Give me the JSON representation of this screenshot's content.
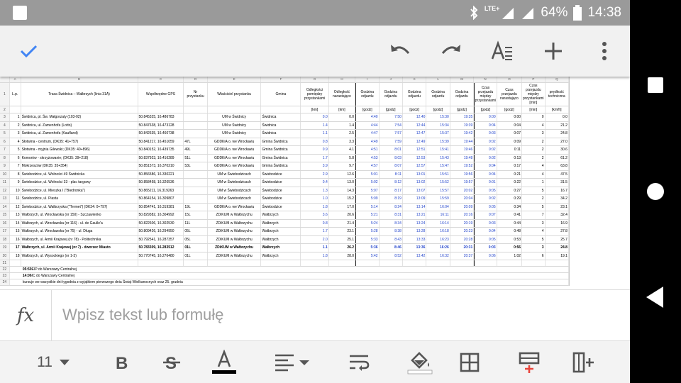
{
  "status_bar": {
    "network": "LTE+",
    "battery": "64%",
    "time": "14:38"
  },
  "toolbar": {
    "confirm_icon": "check-icon",
    "undo_icon": "undo-icon",
    "redo_icon": "redo-icon",
    "format_icon": "text-format-icon",
    "insert_icon": "plus-icon",
    "more_icon": "more-vert-icon"
  },
  "sheet": {
    "col_letters": [
      "",
      "A",
      "B",
      "C",
      "D",
      "E",
      "F",
      "G",
      "H",
      "I",
      "J",
      "K",
      "L",
      "M",
      "N",
      "O",
      "P",
      "Q"
    ],
    "header_row": {
      "num": "1",
      "cells": [
        "L.p.",
        "Trasa Świdnica – Wałbrzych (linia 31A)",
        "Współrzędne GPS",
        "Nr przystanku",
        "Właściciel przystanku",
        "Gmina",
        "Odległości pomiędzy przystankami",
        "Odległość narastająco",
        "Godzina odjazdu",
        "Godzina odjazdu",
        "Godzina odjazdu",
        "Godzina odjazdu",
        "Godzina odjazdu",
        "Czas przejazdu między przystankami",
        "Czas przejazdu narastająco",
        "Czas przejazdu między przystankami [min]",
        "prędkość techniczna"
      ]
    },
    "units_row": {
      "num": "2",
      "cells": [
        "",
        "",
        "",
        "",
        "",
        "",
        "[km]",
        "[km]",
        "[godz]",
        "[godz]",
        "[godz]",
        "[godz]",
        "[godz]",
        "[godz]",
        "[godz]",
        "[min]",
        "[km/h]"
      ]
    },
    "rows": [
      {
        "n": "3",
        "c": [
          "1",
          "Świdnica, pl. Św. Małgorzaty (103-02)",
          "50.845325, 16.486783",
          "",
          "UM w Świdnicy",
          "Świdnica",
          "0.0",
          "0.0",
          "4:40",
          "7:50",
          "12:40",
          "15:30",
          "19:35",
          "0:00",
          "0:00",
          "0",
          "0.0"
        ]
      },
      {
        "n": "4",
        "c": [
          "2",
          "Świdnica, ul. Zamenhofa (Lotto)",
          "50.847638, 16.473128",
          "",
          "UM w Świdnicy",
          "Świdnica",
          "1.4",
          "1.4",
          "4:44",
          "7:54",
          "12:44",
          "15:34",
          "19:39",
          "0:04",
          "0:04",
          "4",
          "21.2"
        ]
      },
      {
        "n": "5",
        "c": [
          "3",
          "Świdnica, ul. Zamenhofa (Kaufland)",
          "50.842635, 16.460738",
          "",
          "UM w Świdnicy",
          "Świdnica",
          "1.1",
          "2.5",
          "4:47",
          "7:57",
          "12:47",
          "15:37",
          "19:42",
          "0:03",
          "0:07",
          "3",
          "24.8"
        ]
      },
      {
        "n": "6",
        "c": [
          "4",
          "Słotwina - centrum, (DK35: 41+757)",
          "50.841217, 16.451059",
          "47L",
          "GDDKiA o. we Wrocławiu",
          "Gmina Świdnica",
          "0.8",
          "3.3",
          "4:49",
          "7:59",
          "12:49",
          "15:39",
          "19:44",
          "0:02",
          "0:09",
          "2",
          "27.0"
        ]
      },
      {
        "n": "7",
        "c": [
          "5",
          "Słotwina - myjnia Gilewski; (DK35: 40+896)",
          "50.840152, 16.439735",
          "49L",
          "GDDKiA o. we Wrocławiu",
          "Gmina Świdnica",
          "0.9",
          "4.1",
          "4:51",
          "8:01",
          "12:51",
          "15:41",
          "19:46",
          "0:02",
          "0:11",
          "2",
          "30.6"
        ]
      },
      {
        "n": "8",
        "c": [
          "6",
          "Komorów - skrzyżowanie; (DK35: 39+218)",
          "50.837923, 16.416289",
          "51L",
          "GDDKiA o. we Wrocławiu",
          "Gmina Świdnica",
          "1.7",
          "5.8",
          "4:53",
          "8:03",
          "12:53",
          "15:43",
          "19:48",
          "0:02",
          "0:13",
          "2",
          "61.2"
        ]
      },
      {
        "n": "9",
        "c": [
          "7",
          "Mokrzeszów (DK35: 35+354)",
          "50.851573, 16.370210",
          "53L",
          "GDDKiA o. we Wrocławiu",
          "Gmina Świdnica",
          "3.9",
          "9.7",
          "4:57",
          "8:07",
          "12:57",
          "15:47",
          "19:52",
          "0:04",
          "0:17",
          "4",
          "63.8"
        ]
      },
      {
        "n": "10",
        "c": [
          "8",
          "Świebodzice, ul. Wolności 49 Świdnicka",
          "50.856586, 16.330221",
          "",
          "UM w Świebodzicach",
          "Świebodzice",
          "2.9",
          "12.6",
          "5:01",
          "8:11",
          "13:01",
          "15:51",
          "19:56",
          "0:04",
          "0:21",
          "4",
          "47.5"
        ]
      },
      {
        "n": "11",
        "c": [
          "9",
          "Świebodzice, ul. Wolności 33 - plac targowy",
          "50.858458, 16.326536",
          "",
          "UM w Świebodzicach",
          "Świebodzice",
          "0.4",
          "13.0",
          "5:02",
          "8:12",
          "13:02",
          "15:52",
          "19:57",
          "0:01",
          "0:22",
          "1",
          "31.5"
        ]
      },
      {
        "n": "12",
        "c": [
          "10",
          "Świebodzice, ul. Mieszka I (\"Biedronka\")",
          "50.865211, 16.319263",
          "",
          "UM w Świebodzicach",
          "Świebodzice",
          "1.3",
          "14.3",
          "5:07",
          "8:17",
          "13:07",
          "15:57",
          "20:02",
          "0:05",
          "0:27",
          "5",
          "16.7"
        ]
      },
      {
        "n": "13",
        "c": [
          "11",
          "Świebodzice, ul. Piasta",
          "50.864154, 16.309807",
          "",
          "UM w Świebodzicach",
          "Świebodzice",
          "1.0",
          "15.2",
          "5:09",
          "8:19",
          "13:09",
          "15:59",
          "20:04",
          "0:02",
          "0:29",
          "2",
          "34.2"
        ]
      },
      {
        "n": "14",
        "c": [
          "12",
          "Świebodzice, ul. Wałbrzyska (\"Termet\") (DK34: 0+797)",
          "50.854741, 16.319381",
          "19L",
          "GDDKiA o. we Wrocławiu",
          "Świebodzice",
          "1.8",
          "17.0",
          "5:14",
          "8:24",
          "13:14",
          "16:04",
          "20:09",
          "0:05",
          "0:34",
          "5",
          "23.1"
        ]
      },
      {
        "n": "15",
        "c": [
          "13",
          "Wałbrzych, ul. Wrocławska (nr 150) - Szczawienko",
          "50.829382, 16.304992",
          "15L",
          "ZDiKUM w Wałbrzychu",
          "Wałbrzych",
          "3.6",
          "20.6",
          "5:21",
          "8:31",
          "13:21",
          "16:11",
          "20:16",
          "0:07",
          "0:41",
          "7",
          "32.4"
        ]
      },
      {
        "n": "16",
        "c": [
          "14",
          "Wałbrzych, ul. Wrocławska (nr 116) - ul. de Gaulle'a",
          "50.822606, 16.302530",
          "11L",
          "ZDiKUM w Wałbrzychu",
          "Wałbrzych",
          "0.8",
          "21.4",
          "5:24",
          "8:34",
          "13:24",
          "16:14",
          "20:19",
          "0:03",
          "0:44",
          "3",
          "16.9"
        ]
      },
      {
        "n": "17",
        "c": [
          "15",
          "Wałbrzych, ul. Wrocławska (nr 75) - ul. Długa",
          "50.809426, 16.294950",
          "05L",
          "ZDiKUM w Wałbrzychu",
          "Wałbrzych",
          "1.7",
          "23.1",
          "5:28",
          "8:38",
          "13:28",
          "16:18",
          "20:23",
          "0:04",
          "0:48",
          "4",
          "27.8"
        ]
      },
      {
        "n": "18",
        "c": [
          "16",
          "Wałbrzych, ul. Armii Krajowej (nr 78) - Politechnika",
          "50.792541, 16.287357",
          "05L",
          "ZDiKUM w Wałbrzychu",
          "Wałbrzych",
          "2.0",
          "25.1",
          "5:33",
          "8:43",
          "13:33",
          "16:23",
          "20:28",
          "0:05",
          "0:53",
          "5",
          "25.7"
        ]
      },
      {
        "n": "19",
        "bold": true,
        "c": [
          "17",
          "Wałbrzych, ul. Armii Krajowej (nr 7) - dworzec Miasto",
          "50.783309, 16.283512",
          "01L",
          "ZDiKUM w Wałbrzychu",
          "Wałbrzych",
          "1.1",
          "26.2",
          "5:36",
          "8:46",
          "13:36",
          "16:26",
          "20:31",
          "0:03",
          "0:56",
          "3",
          "24.8"
        ]
      },
      {
        "n": "20",
        "c": [
          "18",
          "Wałbrzych, ul. Wysockiego (nr 1-3)",
          "50.770745, 16.276480",
          "01L",
          "ZDiKUM w Wałbrzychu",
          "Wałbrzych",
          "1.8",
          "28.0",
          "5:42",
          "8:52",
          "13:42",
          "16:32",
          "20:37",
          "0:06",
          "1:02",
          "6",
          "19.1"
        ]
      }
    ],
    "empty_row_21": "21",
    "notes": [
      {
        "n": "22",
        "bold_part": "05:59",
        "text": " EIP do Warszawy Centralnej"
      },
      {
        "n": "23",
        "bold_part": "14:06",
        "text": " IC do Warszawy Centralnej"
      },
      {
        "n": "24",
        "bold_part": "",
        "text": "kursuje we wszystkie dni tygodnia z wyjątkiem pierwszego dnia Świąt Wielkanocnych oraz 25. grudnia"
      }
    ]
  },
  "formula_bar": {
    "fx_label": "fx",
    "placeholder": "Wpisz tekst lub formułę"
  },
  "format_bar": {
    "font_size": "11",
    "icons": [
      "bold-icon",
      "strikethrough-icon",
      "text-color-icon",
      "align-icon",
      "wrap-text-icon",
      "fill-color-icon",
      "borders-icon",
      "insert-row-icon",
      "insert-column-icon"
    ]
  },
  "colors": {
    "status_bar": "#9a9a9a",
    "toolbar": "#f1f1f1",
    "accent": "#4285f4",
    "blue_values": "#2244cc"
  }
}
